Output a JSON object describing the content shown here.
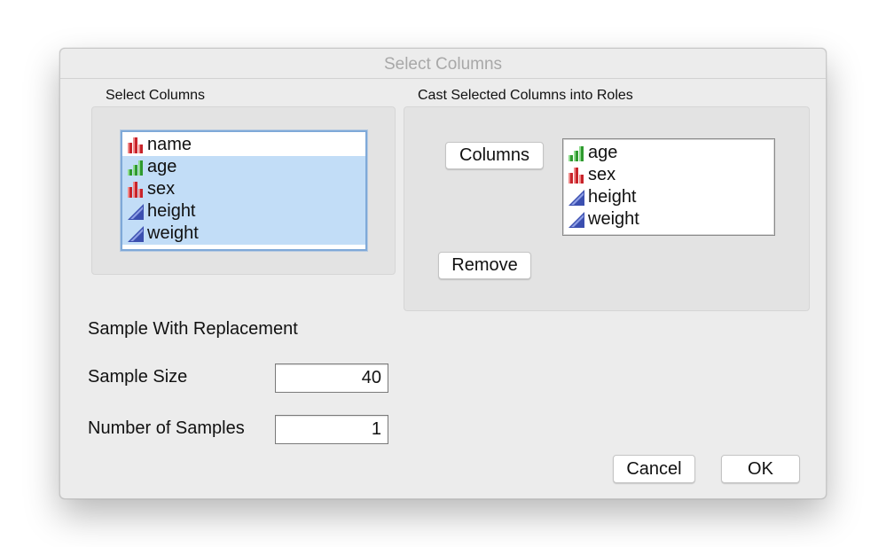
{
  "dialog": {
    "title": "Select Columns"
  },
  "select_columns": {
    "label": "Select Columns",
    "items": [
      {
        "label": "name",
        "icon": "nominal-icon",
        "selected": false
      },
      {
        "label": "age",
        "icon": "ordinal-icon",
        "selected": true
      },
      {
        "label": "sex",
        "icon": "nominal-icon",
        "selected": true
      },
      {
        "label": "height",
        "icon": "continuous-icon",
        "selected": true
      },
      {
        "label": "weight",
        "icon": "continuous-icon",
        "selected": true
      }
    ]
  },
  "roles": {
    "label": "Cast Selected Columns into Roles",
    "columns_button": "Columns",
    "remove_button": "Remove",
    "items": [
      {
        "label": "age",
        "icon": "ordinal-icon"
      },
      {
        "label": "sex",
        "icon": "nominal-icon"
      },
      {
        "label": "height",
        "icon": "continuous-icon"
      },
      {
        "label": "weight",
        "icon": "continuous-icon"
      }
    ]
  },
  "options": {
    "heading": "Sample With Replacement",
    "sample_size_label": "Sample Size",
    "sample_size_value": "40",
    "num_samples_label": "Number of Samples",
    "num_samples_value": "1"
  },
  "buttons": {
    "cancel": "Cancel",
    "ok": "OK"
  },
  "colors": {
    "nominal": "#c8232a",
    "ordinal": "#2f9a2f",
    "continuous": "#3b4fb0",
    "selection": "#c2ddf7"
  }
}
